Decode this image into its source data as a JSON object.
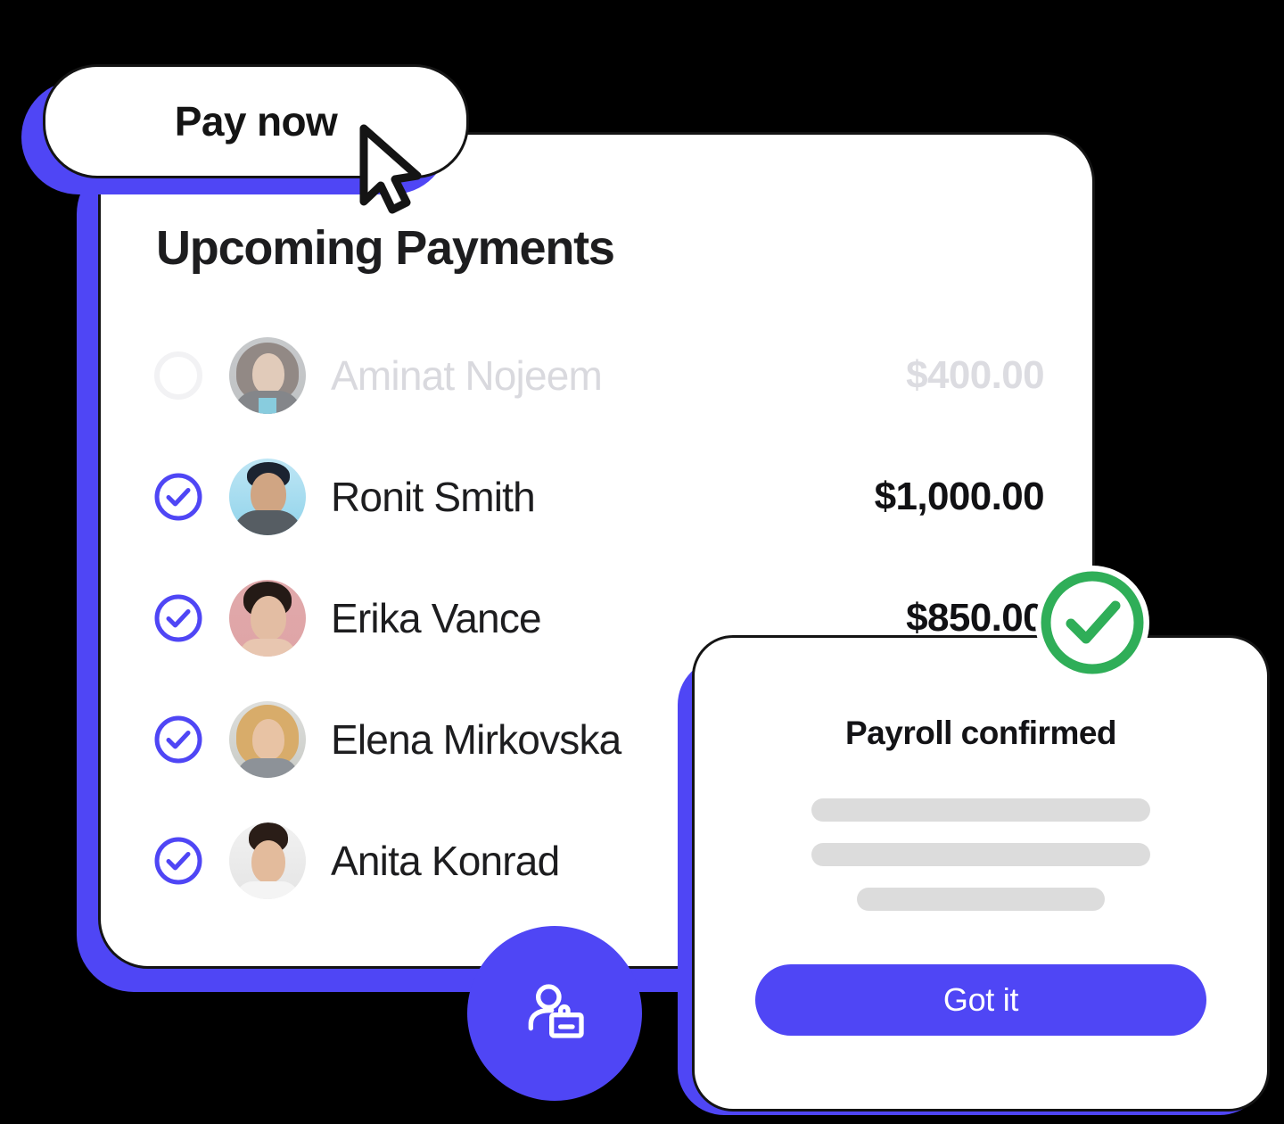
{
  "theme": {
    "accent": "#4F46F5",
    "success": "#2FAE58",
    "ink": "#141414",
    "muted": "#d9d9de",
    "skeleton": "#dcdcdc",
    "surface": "#ffffff",
    "backdrop": "#000000"
  },
  "pay_now_button": {
    "label": "Pay now",
    "cursor_icon": "mouse-pointer-icon"
  },
  "card": {
    "title": "Upcoming Payments",
    "rows": [
      {
        "name": "Aminat Nojeem",
        "amount": "$400.00",
        "checked": false,
        "state": "pending",
        "check_icon": "circle-empty-icon",
        "avatar": "avatar-aminat-nojeem"
      },
      {
        "name": "Ronit Smith",
        "amount": "$1,000.00",
        "checked": true,
        "state": "selected",
        "check_icon": "check-circle-icon",
        "avatar": "avatar-ronit-smith"
      },
      {
        "name": "Erika Vance",
        "amount": "$850.00",
        "checked": true,
        "state": "selected",
        "check_icon": "check-circle-icon",
        "avatar": "avatar-erika-vance"
      },
      {
        "name": "Elena Mirkovska",
        "amount": "",
        "checked": true,
        "state": "selected",
        "check_icon": "check-circle-icon",
        "avatar": "avatar-elena-mirkovska"
      },
      {
        "name": "Anita Konrad",
        "amount": "",
        "checked": true,
        "state": "selected",
        "check_icon": "check-circle-icon",
        "avatar": "avatar-anita-konrad"
      }
    ]
  },
  "add_person_fab": {
    "icon": "person-badge-icon"
  },
  "confirm_modal": {
    "status_icon": "check-circle-success-icon",
    "title": "Payroll confirmed",
    "skeleton_lines": 3,
    "primary_button": "Got it"
  }
}
